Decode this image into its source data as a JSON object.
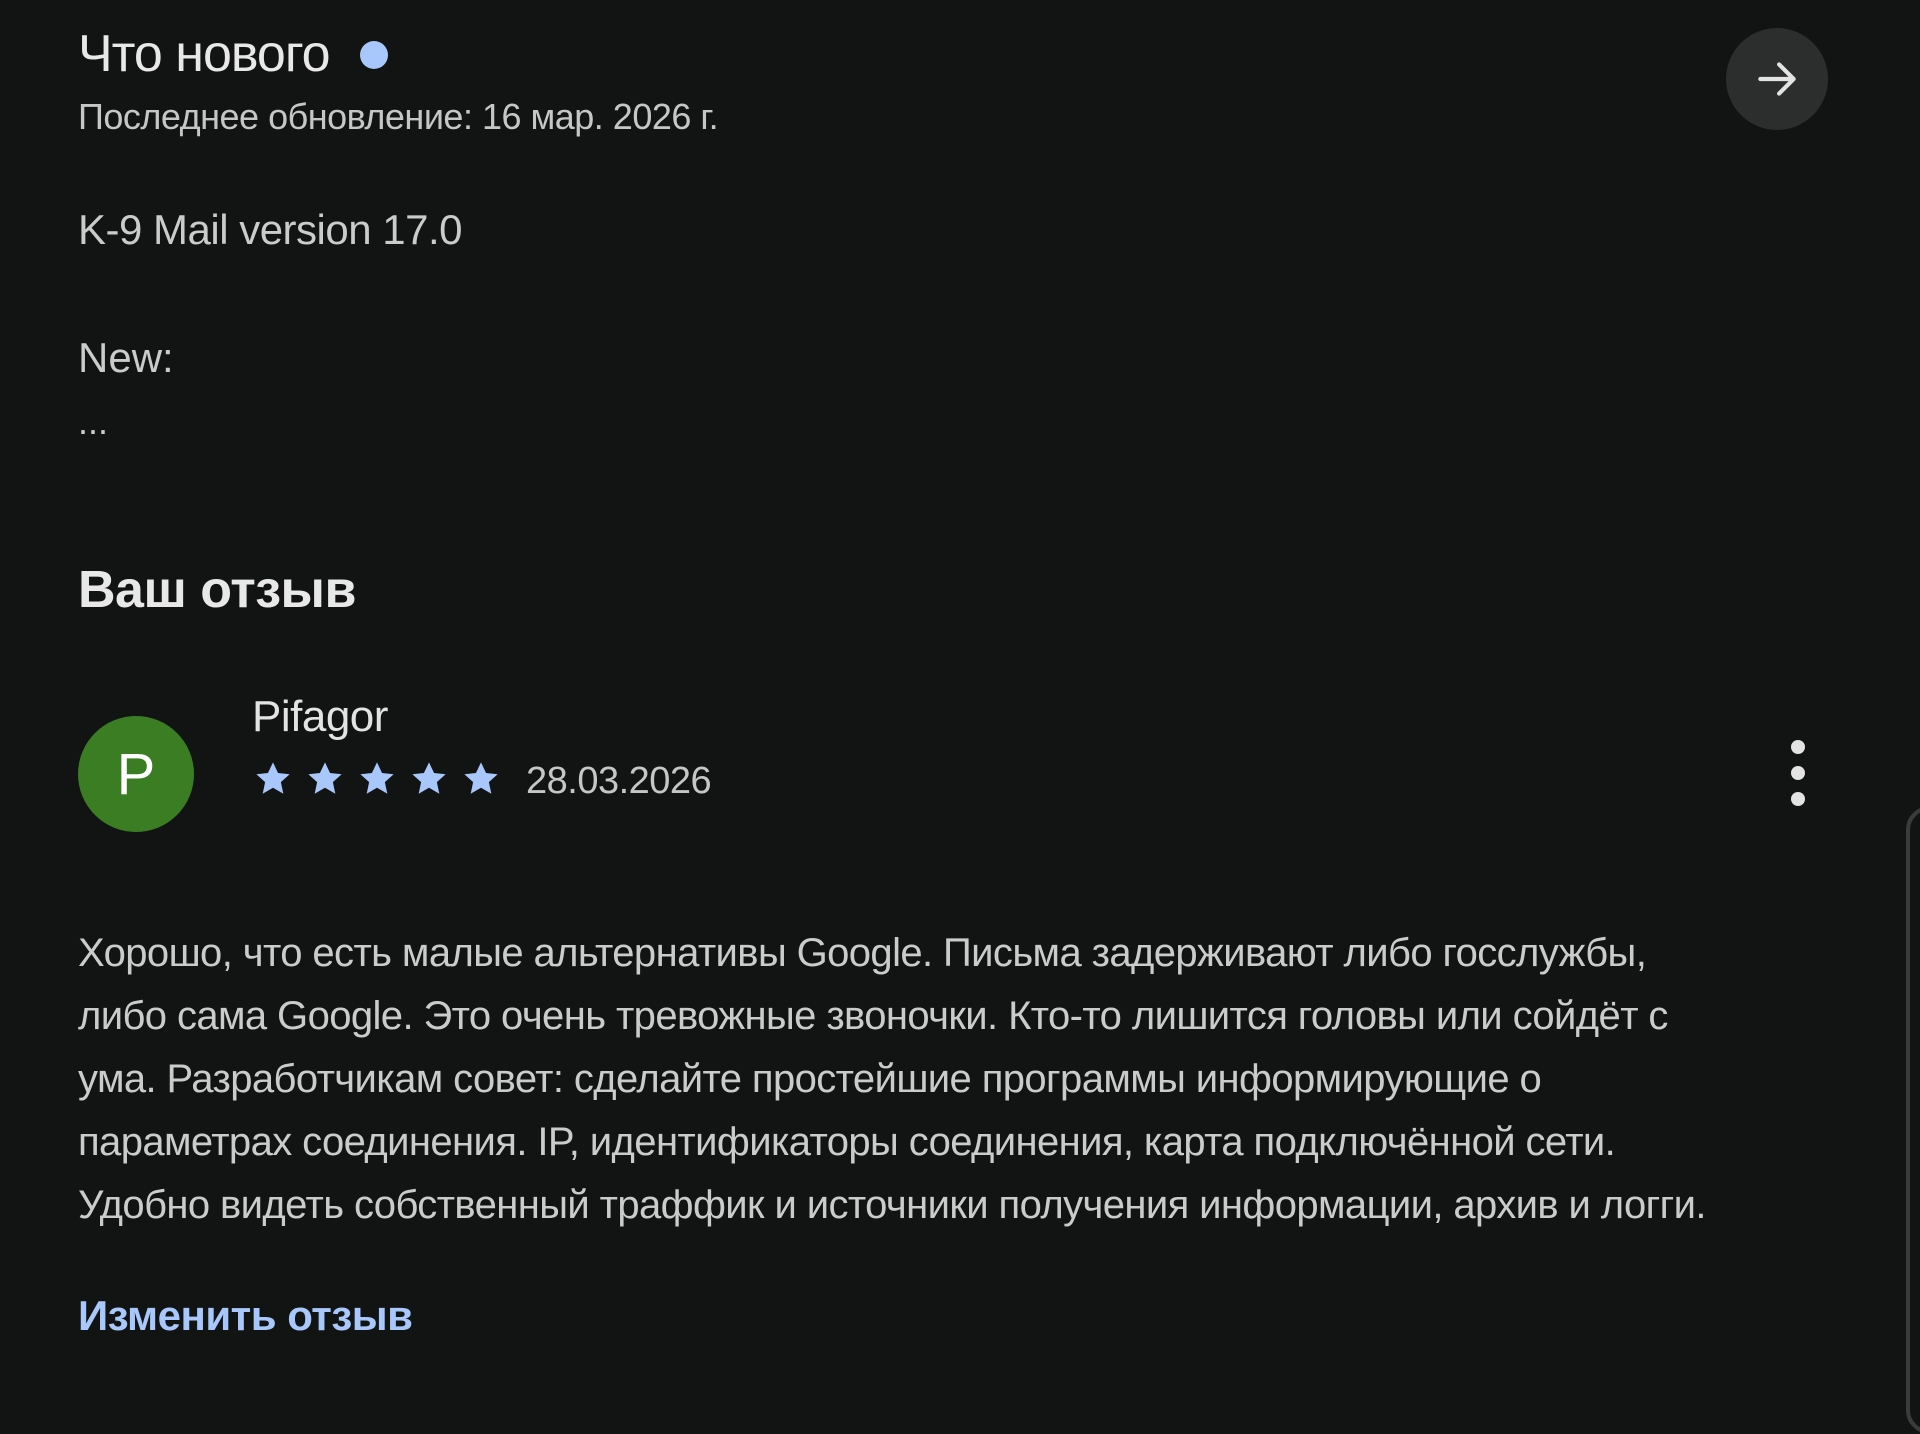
{
  "whats_new": {
    "title": "Что нового",
    "last_updated": "Последнее обновление: 16 мар. 2026 г.",
    "notes_version": "K-9 Mail version 17.0",
    "notes_new_label": "New:",
    "notes_more": "..."
  },
  "icons": {
    "arrow": "arrow-right-icon",
    "new_indicator": "dot",
    "star": "star-icon",
    "more": "more-vert-icon"
  },
  "your_review": {
    "heading": "Ваш отзыв",
    "avatar_letter": "P",
    "author": "Pifagor",
    "rating": 5,
    "rating_max": 5,
    "date": "28.03.2026",
    "text_lines": [
      "Хорошо, что есть малые альтернативы Google. Письма задерживают либо госслужбы,",
      "либо сама Google. Это очень тревожные звоночки. Кто-то лишится головы или сойдёт с",
      "ума. Разработчикам совет: сделайте простейшие программы информирующие о",
      "параметрах соединения. IP, идентификаторы соединения, карта подключённой сети.",
      "Удобно видеть собственный траффик и источники получения информации, архив и логги."
    ],
    "edit_label": "Изменить отзыв"
  },
  "colors": {
    "background": "#121413",
    "accent": "#a8c7fa",
    "avatar": "#3b7d22",
    "arrow_button_bg": "#2c2e2d"
  }
}
